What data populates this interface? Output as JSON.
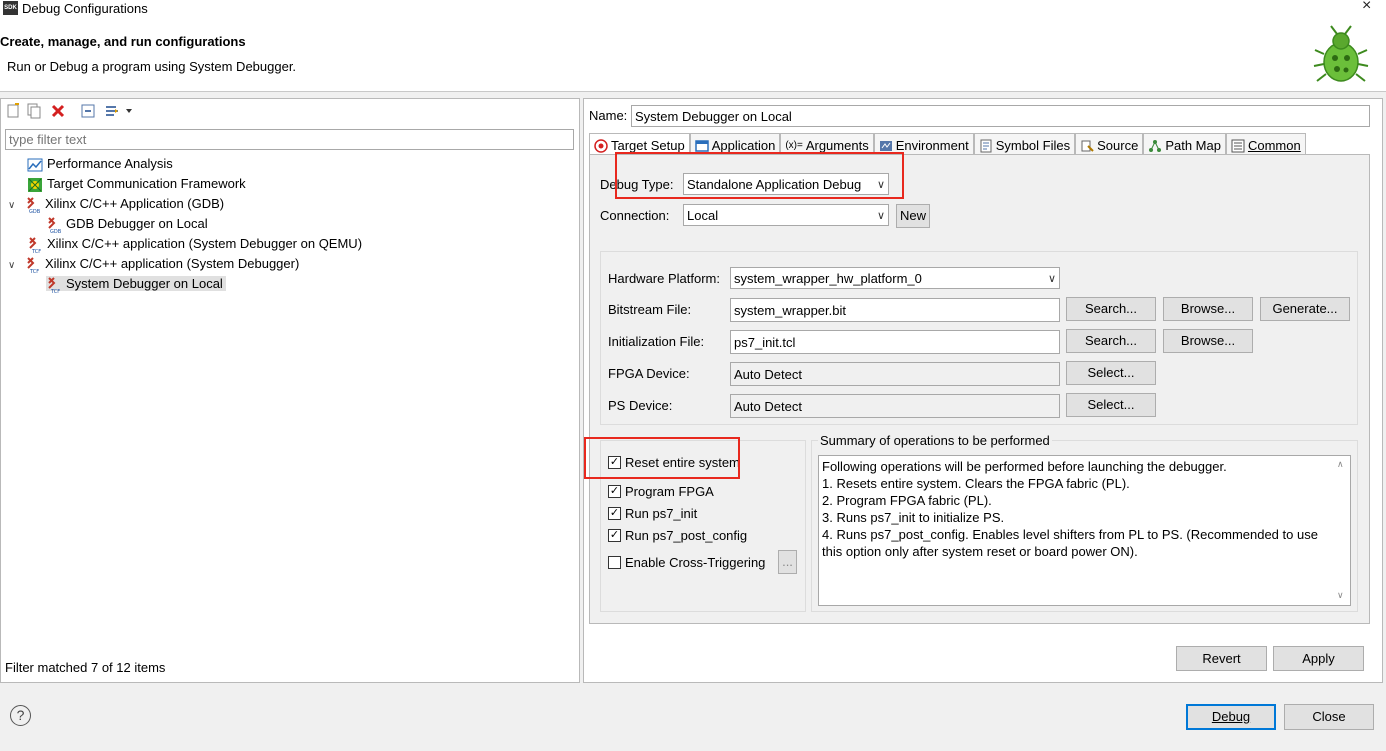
{
  "window": {
    "title": "Debug Configurations",
    "app_icon_text": "SDK",
    "close_glyph": "×"
  },
  "header": {
    "title": "Create, manage, and run configurations",
    "subtitle": "Run or Debug a program using System Debugger."
  },
  "left": {
    "filter_placeholder": "type filter text",
    "tree": [
      {
        "label": "Performance Analysis",
        "icon": "performance-analysis-icon",
        "level": 0
      },
      {
        "label": "Target Communication Framework",
        "icon": "tcf-icon",
        "level": 0
      },
      {
        "label": "Xilinx C/C++ Application (GDB)",
        "icon": "xilinx-gdb-icon",
        "level": 0,
        "expanded": true
      },
      {
        "label": "GDB Debugger on Local",
        "icon": "gdb-config-icon",
        "level": 1
      },
      {
        "label": "Xilinx C/C++ application (System Debugger on QEMU)",
        "icon": "xilinx-tcf-icon",
        "level": 0
      },
      {
        "label": "Xilinx C/C++ application (System Debugger)",
        "icon": "xilinx-tcf-icon",
        "level": 0,
        "expanded": true
      },
      {
        "label": "System Debugger on Local",
        "icon": "tcf-config-icon",
        "level": 1,
        "selected": true
      }
    ],
    "filter_status": "Filter matched 7 of 12 items"
  },
  "right": {
    "name_label": "Name:",
    "name_value": "System Debugger on Local",
    "tabs": [
      "Target Setup",
      "Application",
      "Arguments",
      "Environment",
      "Symbol Files",
      "Source",
      "Path Map",
      "Common"
    ],
    "arguments_tab_prefix": "(x)=",
    "debug_type_label": "Debug Type:",
    "debug_type_value": "Standalone Application Debug",
    "connection_label": "Connection:",
    "connection_value": "Local",
    "new_button": "New",
    "hw_platform_label": "Hardware Platform:",
    "hw_platform_value": "system_wrapper_hw_platform_0",
    "bitstream_label": "Bitstream File:",
    "bitstream_value": "system_wrapper.bit",
    "init_label": "Initialization File:",
    "init_value": "ps7_init.tcl",
    "fpga_label": "FPGA Device:",
    "fpga_value": "Auto Detect",
    "ps_label": "PS Device:",
    "ps_value": "Auto Detect",
    "search_btn": "Search...",
    "browse_btn": "Browse...",
    "generate_btn": "Generate...",
    "select_btn": "Select...",
    "checkboxes": [
      {
        "label": "Reset entire system",
        "checked": true
      },
      {
        "label": "Program FPGA",
        "checked": true
      },
      {
        "label": "Run ps7_init",
        "checked": true
      },
      {
        "label": "Run ps7_post_config",
        "checked": true
      },
      {
        "label": "Enable Cross-Triggering",
        "checked": false
      }
    ],
    "checkmark_glyph": "✓",
    "cross_trigger_btn": "...",
    "summary_title": "Summary of operations to be performed",
    "summary_lines": [
      "Following operations will be performed before launching the debugger.",
      "1. Resets entire system. Clears the FPGA fabric (PL).",
      "2. Program FPGA fabric (PL).",
      "3. Runs ps7_init to initialize PS.",
      "4. Runs ps7_post_config. Enables level shifters from PL to PS. (Recommended to use",
      "this option only after system reset or board power ON)."
    ],
    "revert_btn": "Revert",
    "apply_btn": "Apply"
  },
  "footer": {
    "help_glyph": "?",
    "debug_btn": "Debug",
    "close_btn": "Close"
  },
  "colors": {
    "highlight_box": "#e8281e",
    "default_button_border": "#0078d7"
  }
}
